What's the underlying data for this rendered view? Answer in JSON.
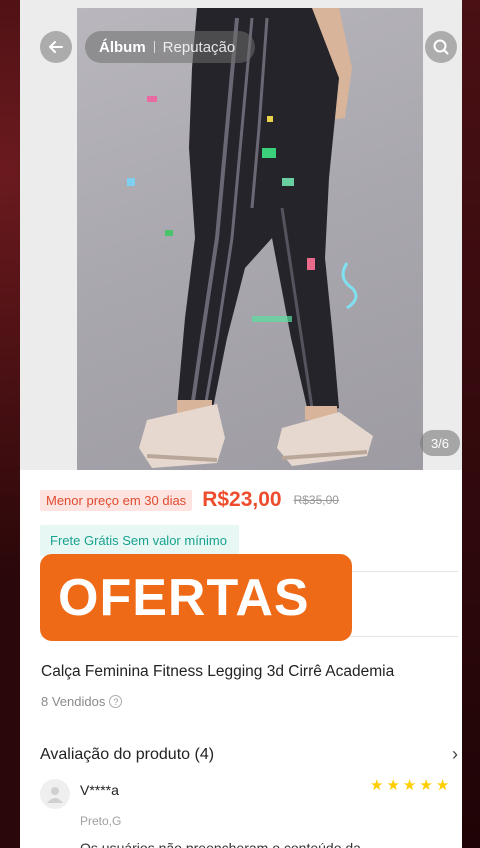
{
  "header": {
    "tabs": [
      {
        "label": "Álbum",
        "active": true
      },
      {
        "label": "Reputação",
        "active": false
      }
    ],
    "back_icon": "arrow-left-icon",
    "search_icon": "search-icon"
  },
  "gallery": {
    "counter": "3/6"
  },
  "price": {
    "lowest_badge": "Menor preço em 30 dias",
    "current": "R$23,00",
    "original": "R$35,00",
    "accent_color": "#ee4d2d"
  },
  "shipping": {
    "badge": "Frete Grátis Sem valor mínimo",
    "color": "#18a28f"
  },
  "promo": {
    "label": "OFERTAS",
    "color": "#ef6a16"
  },
  "product": {
    "title": "Calça Feminina Fitness Legging 3d Cirrê Academia",
    "sold": "8 Vendidos",
    "help_icon": "?"
  },
  "reviews": {
    "title": "Avaliação do produto (4)",
    "items": [
      {
        "user": "V****a",
        "rating": 5,
        "variant": "Preto,G",
        "text": "Os usuários não preencheram o conteúdo da"
      }
    ]
  }
}
